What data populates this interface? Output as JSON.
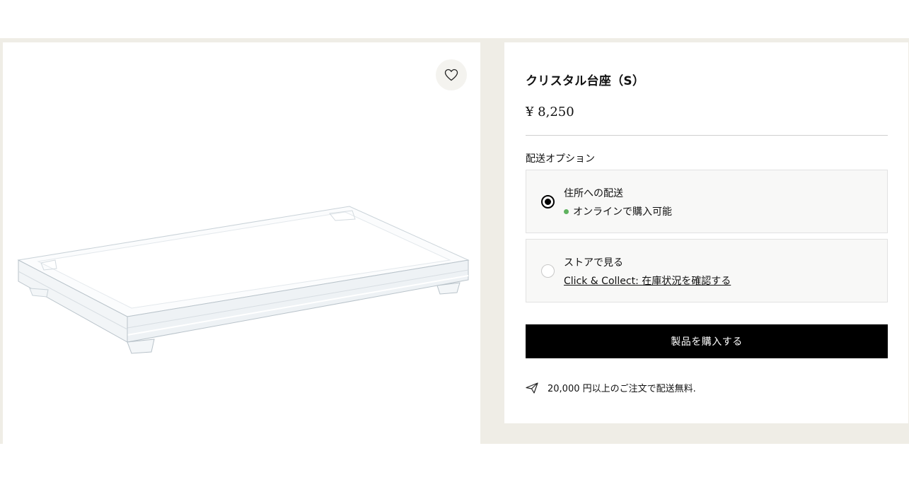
{
  "product": {
    "title": "クリスタル台座（S）",
    "price": "¥ 8,250",
    "image_alt": "crystal-tray-image"
  },
  "shipping": {
    "label": "配送オプション",
    "options": [
      {
        "title": "住所への配送",
        "status": "オンラインで購入可能",
        "status_color": "#5fb25f",
        "selected": true
      },
      {
        "title": "ストアで見る",
        "link": "Click & Collect: 在庫状況を確認する",
        "selected": false
      }
    ]
  },
  "actions": {
    "buy_label": "製品を購入する",
    "favorite_icon": "heart-icon"
  },
  "notice": {
    "icon": "paper-plane-icon",
    "text": "20,000 円以上のご注文で配送無料."
  },
  "colors": {
    "background": "#efede6",
    "button": "#000000",
    "available_dot": "#5fb25f"
  }
}
